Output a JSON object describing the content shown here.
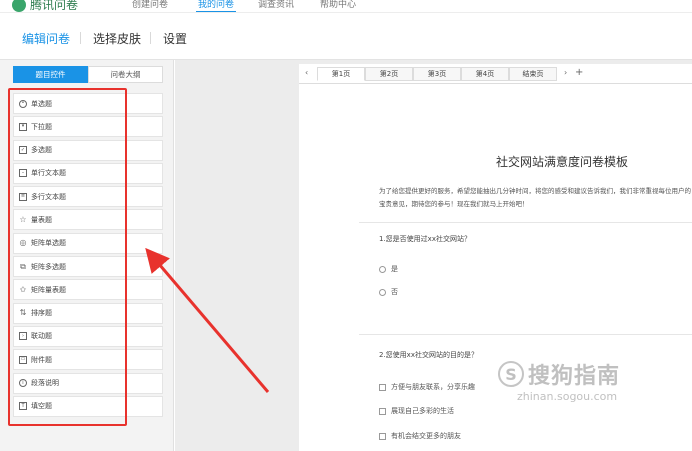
{
  "app": {
    "logo_text": "腾讯问卷"
  },
  "topnav": {
    "items": [
      "创建问卷",
      "我的问卷",
      "调查资讯",
      "帮助中心"
    ],
    "active_index": 1
  },
  "subbar": {
    "tabs": [
      "编辑问卷",
      "选择皮肤",
      "设置"
    ],
    "active_index": 0
  },
  "left_panel": {
    "tabs": [
      "题目控件",
      "问卷大纲"
    ],
    "active_tab": 0,
    "question_types": [
      {
        "label": "单选题",
        "icon": "radio-icon"
      },
      {
        "label": "下拉题",
        "icon": "dropdown-icon"
      },
      {
        "label": "多选题",
        "icon": "checkbox-icon"
      },
      {
        "label": "单行文本题",
        "icon": "single-line-text-icon"
      },
      {
        "label": "多行文本题",
        "icon": "multi-line-text-icon"
      },
      {
        "label": "量表题",
        "icon": "star-icon"
      },
      {
        "label": "矩阵单选题",
        "icon": "matrix-radio-icon"
      },
      {
        "label": "矩阵多选题",
        "icon": "matrix-checkbox-icon"
      },
      {
        "label": "矩阵量表题",
        "icon": "matrix-star-icon"
      },
      {
        "label": "排序题",
        "icon": "sort-icon"
      },
      {
        "label": "联动题",
        "icon": "linkage-icon"
      },
      {
        "label": "附件题",
        "icon": "attachment-icon"
      },
      {
        "label": "段落说明",
        "icon": "info-icon"
      },
      {
        "label": "填空题",
        "icon": "fill-blank-icon"
      }
    ]
  },
  "page_tabs": {
    "prev": "‹",
    "tabs": [
      "第1页",
      "第2页",
      "第3页",
      "第4页",
      "结束页"
    ],
    "next": "›",
    "add": "+"
  },
  "survey": {
    "title": "社交网站满意度问卷模板",
    "intro": "为了给您提供更好的服务，希望您能抽出几分钟时间，将您的感受和建议告诉我们，我们非常重视每位用户的宝贵意见，期待您的参与！现在我们就马上开始吧！",
    "questions": [
      {
        "title": "1.您是否使用过xx社交网站？",
        "options": [
          "是",
          "否"
        ]
      },
      {
        "title": "2.您使用xx社交网站的目的是？",
        "options": [
          "方便与朋友联系，分享乐趣",
          "展现自己多彩的生活",
          "有机会结交更多的朋友"
        ]
      }
    ]
  },
  "watermark": {
    "text": "搜狗指南",
    "url": "zhinan.sogou.com"
  },
  "colors": {
    "accent": "#1a93e6",
    "annotation_red": "#e8322d"
  }
}
